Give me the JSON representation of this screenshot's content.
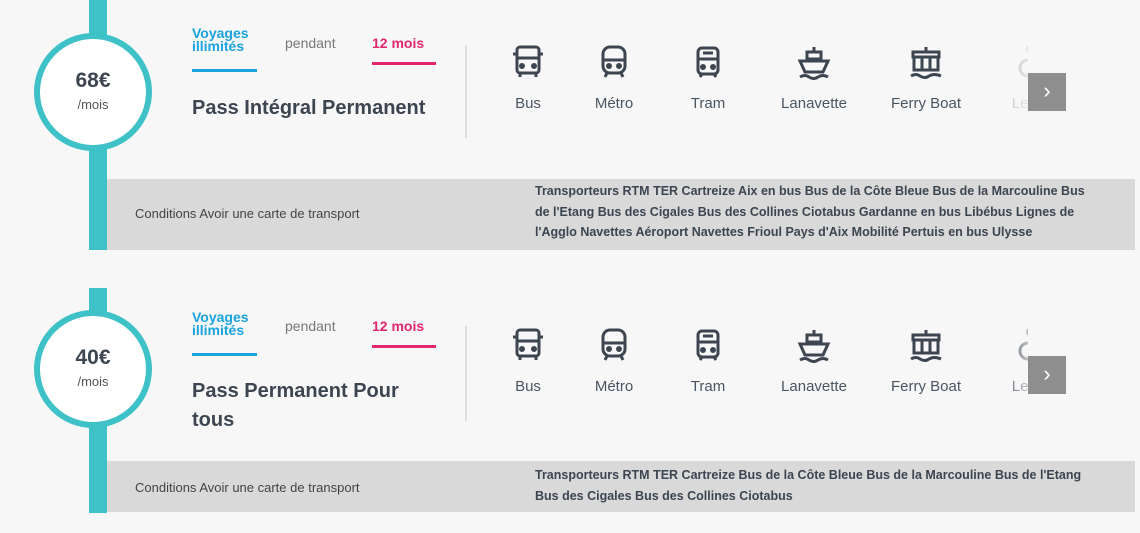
{
  "colors": {
    "accent_teal": "#3ec1c7",
    "voyages_blue": "#1aa3dc",
    "mois_pink": "#e2276f",
    "conditions_bg": "#d9d9d9",
    "next_button": "#8e8e8e"
  },
  "passes": [
    {
      "price": "68€",
      "per": "/mois",
      "voyages_label": "Voyages illimités",
      "pendant_label": "pendant",
      "duration": "12 mois",
      "name": "Pass Intégral Permanent",
      "modes": [
        {
          "label": "Bus",
          "icon": "bus-icon"
        },
        {
          "label": "Métro",
          "icon": "metro-icon"
        },
        {
          "label": "Tram",
          "icon": "tram-icon"
        },
        {
          "label": "Lanavette",
          "icon": "boat-icon"
        },
        {
          "label": "Ferry Boat",
          "icon": "ferry-icon"
        },
        {
          "label": "Levé",
          "icon": "wheelchair-lift-icon"
        }
      ],
      "next_label": "›",
      "conditions": "Conditions Avoir une carte de transport",
      "transporters": "Transporteurs RTM TER Cartreize Aix en bus Bus de la Côte Bleue Bus de la Marcouline Bus de l'Etang Bus des Cigales Bus des Collines Ciotabus Gardanne en bus Libébus Lignes de l'Agglo Navettes Aéroport Navettes Frioul Pays d'Aix Mobilité Pertuis en bus Ulysse"
    },
    {
      "price": "40€",
      "per": "/mois",
      "voyages_label": "Voyages illimités",
      "pendant_label": "pendant",
      "duration": "12 mois",
      "name": "Pass Permanent Pour tous",
      "modes": [
        {
          "label": "Bus",
          "icon": "bus-icon"
        },
        {
          "label": "Métro",
          "icon": "metro-icon"
        },
        {
          "label": "Tram",
          "icon": "tram-icon"
        },
        {
          "label": "Lanavette",
          "icon": "boat-icon"
        },
        {
          "label": "Ferry Boat",
          "icon": "ferry-icon"
        },
        {
          "label": "Levé",
          "icon": "wheelchair-lift-icon"
        }
      ],
      "next_label": "›",
      "conditions": "Conditions Avoir une carte de transport",
      "transporters": "Transporteurs RTM TER Cartreize Bus de la Côte Bleue Bus de la Marcouline Bus de l'Etang Bus des Cigales Bus des Collines Ciotabus"
    }
  ]
}
